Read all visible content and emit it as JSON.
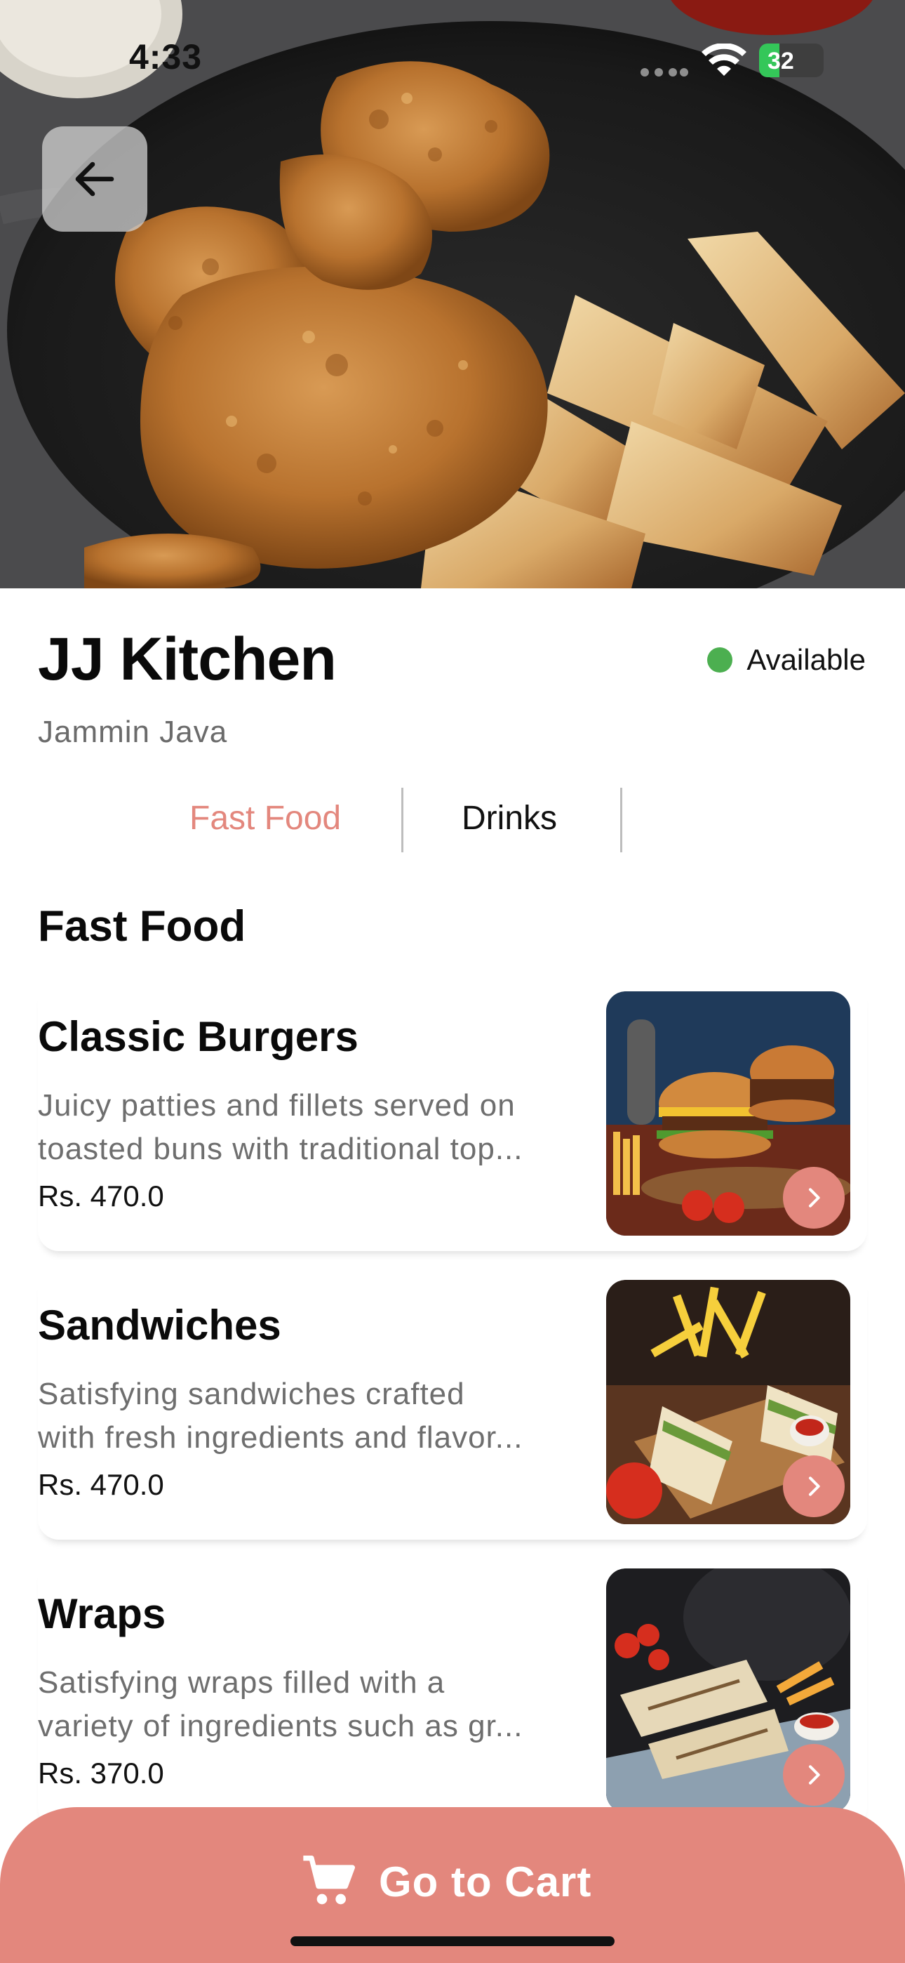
{
  "status_bar": {
    "time": "4:33",
    "battery": "32",
    "icons": [
      "signal-dots-icon",
      "wifi-icon",
      "battery-charging-icon"
    ]
  },
  "header": {
    "back_icon": "arrow-left-icon",
    "hero_image": "fried-chicken-and-wedges-photo"
  },
  "restaurant": {
    "name": "JJ Kitchen",
    "subtitle": "Jammin Java",
    "status": "Available",
    "status_color": "#4caf50"
  },
  "tabs": [
    {
      "label": "Fast Food",
      "active": true
    },
    {
      "label": "Drinks",
      "active": false
    }
  ],
  "section": {
    "title": "Fast Food"
  },
  "menu_items": [
    {
      "name": "Classic Burgers",
      "desc_line1": "Juicy patties and fillets served on",
      "desc_line2": "toasted buns with traditional top...",
      "price": "Rs. 470.0",
      "image": "burgers-photo"
    },
    {
      "name": "Sandwiches",
      "desc_line1": "Satisfying sandwiches crafted",
      "desc_line2": "with fresh ingredients and flavor...",
      "price": "Rs. 470.0",
      "image": "sandwiches-photo"
    },
    {
      "name": "Wraps",
      "desc_line1": "Satisfying wraps filled with a",
      "desc_line2": "variety of ingredients such as gr...",
      "price": "Rs. 370.0",
      "image": "wraps-photo"
    }
  ],
  "cart": {
    "label": "Go to Cart",
    "icon": "cart-icon"
  },
  "colors": {
    "accent": "#e3877d",
    "available": "#4caf50",
    "muted_text": "#6e6e6e"
  }
}
